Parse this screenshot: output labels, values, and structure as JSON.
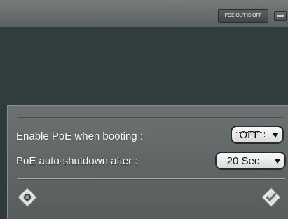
{
  "header": {
    "poe_status": "POE OUT IS OFF"
  },
  "settings": {
    "enable_poe": {
      "label": "Enable PoE when booting :",
      "value": "OFF"
    },
    "auto_shutdown": {
      "label": "PoE auto-shutdown after :",
      "value": "20 Sec"
    }
  },
  "icons": {
    "back": "back-diamond-icon",
    "confirm": "confirm-check-icon",
    "tray": "tray-toggle-icon",
    "dropdown_arrow": "chevron-down-icon"
  },
  "colors": {
    "panel": "#5f6465",
    "viewport": "#313d3e",
    "dropdown": "#eeeeee"
  }
}
